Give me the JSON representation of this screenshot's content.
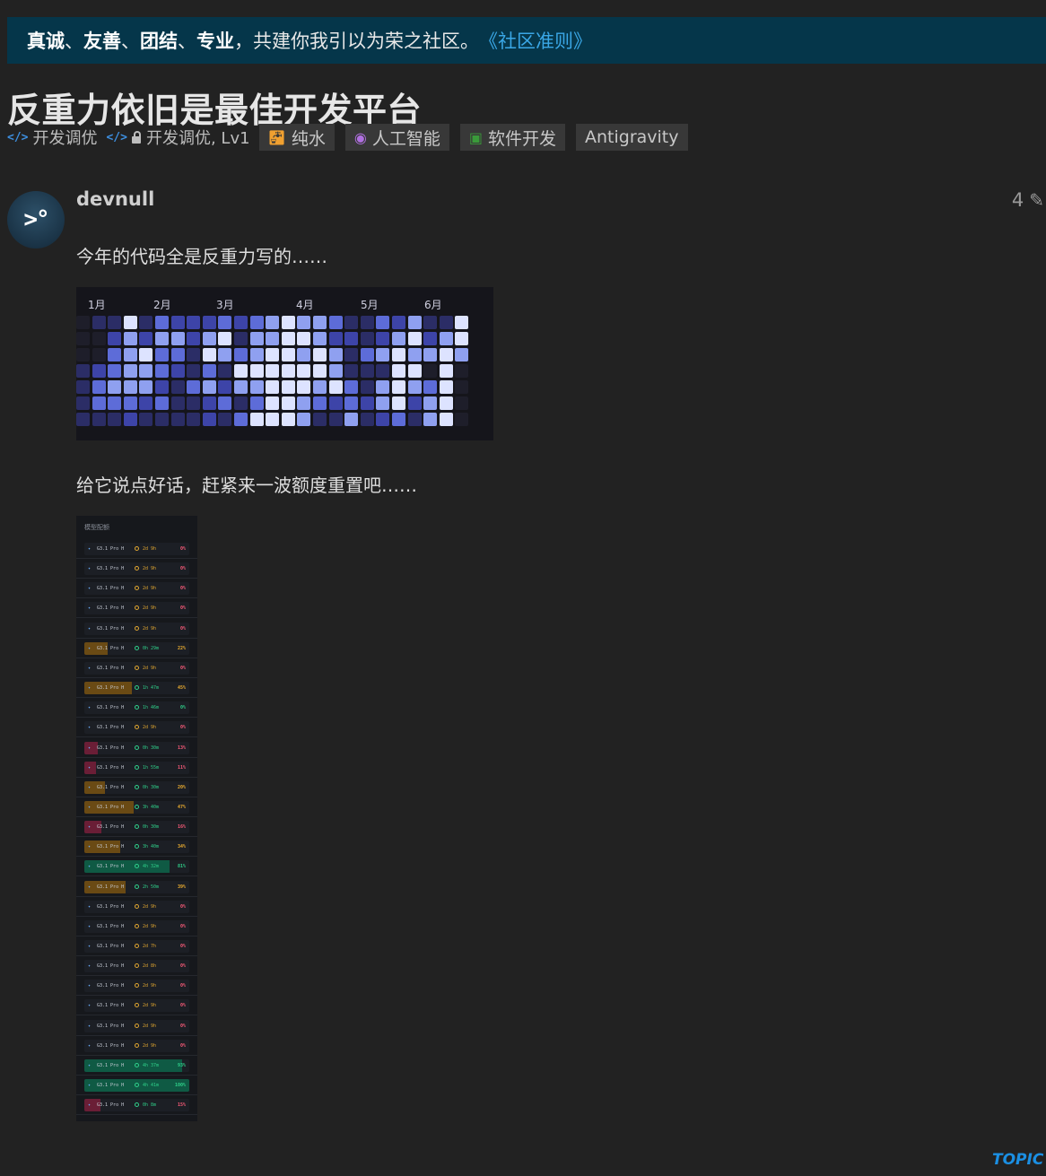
{
  "banner": {
    "bold1": "真诚",
    "sep1": "、",
    "bold2": "友善",
    "sep2": "、",
    "bold3": "团结",
    "sep3": "、",
    "bold4": "专业",
    "rest": "，共建你我引以为荣之社区。",
    "link": "《社区准则》"
  },
  "topic": {
    "title": "反重力依旧是最佳开发平台",
    "breadcrumbs": [
      "开发调优",
      "开发调优, Lv1"
    ],
    "tags": [
      {
        "label": "纯水",
        "icon": "faucet-icon",
        "color": "#f0a030"
      },
      {
        "label": "人工智能",
        "icon": "brain-icon",
        "color": "#b070e0"
      },
      {
        "label": "软件开发",
        "icon": "file-code-icon",
        "color": "#3a9a3a"
      },
      {
        "label": "Antigravity",
        "icon": "",
        "color": ""
      }
    ]
  },
  "post": {
    "avatar_text": ">°",
    "username": "devnull",
    "edit_count": "4",
    "paragraph1": "今年的代码全是反重力写的……",
    "paragraph2": "给它说点好话，赶紧来一波额度重置吧……"
  },
  "heatmap": {
    "months": [
      "1月",
      "2月",
      "3月",
      "4月",
      "5月",
      "6月"
    ],
    "colors": [
      "#1e1e2a",
      "#2b2d66",
      "#3d44a8",
      "#5d6cd8",
      "#8fa0f0",
      "#dde3ff"
    ],
    "columns": [
      [
        0,
        0,
        0,
        1,
        1,
        1,
        1
      ],
      [
        1,
        0,
        0,
        2,
        3,
        3,
        1
      ],
      [
        1,
        2,
        3,
        3,
        4,
        3,
        1
      ],
      [
        5,
        4,
        4,
        4,
        4,
        3,
        2
      ],
      [
        1,
        2,
        5,
        4,
        4,
        2,
        1
      ],
      [
        3,
        4,
        3,
        3,
        2,
        3,
        1
      ],
      [
        2,
        4,
        3,
        2,
        1,
        1,
        1
      ],
      [
        2,
        2,
        1,
        1,
        3,
        1,
        1
      ],
      [
        2,
        4,
        5,
        3,
        4,
        2,
        2
      ],
      [
        3,
        5,
        4,
        1,
        2,
        3,
        1
      ],
      [
        2,
        1,
        3,
        5,
        4,
        1,
        3
      ],
      [
        3,
        4,
        4,
        5,
        4,
        3,
        5
      ],
      [
        4,
        4,
        5,
        5,
        5,
        5,
        5
      ],
      [
        5,
        5,
        5,
        5,
        5,
        5,
        5
      ],
      [
        4,
        5,
        4,
        5,
        5,
        4,
        4
      ],
      [
        4,
        4,
        5,
        5,
        4,
        3,
        1
      ],
      [
        3,
        2,
        4,
        4,
        5,
        2,
        1
      ],
      [
        1,
        2,
        1,
        1,
        3,
        3,
        4
      ],
      [
        1,
        1,
        3,
        1,
        1,
        2,
        1
      ],
      [
        3,
        2,
        4,
        1,
        4,
        4,
        2
      ],
      [
        2,
        4,
        5,
        5,
        5,
        5,
        3
      ],
      [
        4,
        5,
        4,
        5,
        4,
        2,
        1
      ],
      [
        1,
        2,
        4,
        0,
        3,
        4,
        4
      ],
      [
        1,
        4,
        5,
        5,
        5,
        5,
        5
      ],
      [
        5,
        5,
        4,
        0,
        0,
        0,
        0
      ]
    ]
  },
  "quota": {
    "header": "模型配额",
    "rows": [
      {
        "name": "G3.1 Pro H",
        "time": "2d 9h",
        "pct": "0%",
        "fill": 0,
        "tone": "yellow"
      },
      {
        "name": "G3.1 Pro H",
        "time": "2d 9h",
        "pct": "0%",
        "fill": 0,
        "tone": "yellow"
      },
      {
        "name": "G3.1 Pro H",
        "time": "2d 9h",
        "pct": "0%",
        "fill": 0,
        "tone": "yellow"
      },
      {
        "name": "G3.1 Pro H",
        "time": "2d 9h",
        "pct": "0%",
        "fill": 0,
        "tone": "yellow"
      },
      {
        "name": "G3.1 Pro H",
        "time": "2d 9h",
        "pct": "0%",
        "fill": 0,
        "tone": "yellow"
      },
      {
        "name": "G3.1 Pro H",
        "time": "0h 29m",
        "pct": "22%",
        "fill": 22,
        "tone": "amber"
      },
      {
        "name": "G3.1 Pro H",
        "time": "2d 9h",
        "pct": "0%",
        "fill": 0,
        "tone": "yellow"
      },
      {
        "name": "G3.1 Pro H",
        "time": "1h 47m",
        "pct": "45%",
        "fill": 45,
        "tone": "amber"
      },
      {
        "name": "G3.1 Pro H",
        "time": "1h 46m",
        "pct": "0%",
        "fill": 0,
        "tone": "green"
      },
      {
        "name": "G3.1 Pro H",
        "time": "2d 9h",
        "pct": "0%",
        "fill": 0,
        "tone": "yellow"
      },
      {
        "name": "G3.1 Pro H",
        "time": "0h 30m",
        "pct": "13%",
        "fill": 13,
        "tone": "red"
      },
      {
        "name": "G3.1 Pro H",
        "time": "1h 55m",
        "pct": "11%",
        "fill": 11,
        "tone": "red"
      },
      {
        "name": "G3.1 Pro H",
        "time": "0h 30m",
        "pct": "20%",
        "fill": 20,
        "tone": "amber"
      },
      {
        "name": "G3.1 Pro H",
        "time": "3h 40m",
        "pct": "47%",
        "fill": 47,
        "tone": "amber"
      },
      {
        "name": "G3.1 Pro H",
        "time": "0h 30m",
        "pct": "16%",
        "fill": 16,
        "tone": "red"
      },
      {
        "name": "G3.1 Pro H",
        "time": "3h 40m",
        "pct": "34%",
        "fill": 34,
        "tone": "amber"
      },
      {
        "name": "G3.1 Pro H",
        "time": "4h 32m",
        "pct": "81%",
        "fill": 81,
        "tone": "green"
      },
      {
        "name": "G3.1 Pro H",
        "time": "2h 50m",
        "pct": "39%",
        "fill": 39,
        "tone": "amber"
      },
      {
        "name": "G3.1 Pro H",
        "time": "2d 9h",
        "pct": "0%",
        "fill": 0,
        "tone": "yellow"
      },
      {
        "name": "G3.1 Pro H",
        "time": "2d 9h",
        "pct": "0%",
        "fill": 0,
        "tone": "yellow"
      },
      {
        "name": "G3.1 Pro H",
        "time": "2d 7h",
        "pct": "0%",
        "fill": 0,
        "tone": "yellow"
      },
      {
        "name": "G3.1 Pro H",
        "time": "2d 8h",
        "pct": "0%",
        "fill": 0,
        "tone": "yellow"
      },
      {
        "name": "G3.1 Pro H",
        "time": "2d 9h",
        "pct": "0%",
        "fill": 0,
        "tone": "yellow"
      },
      {
        "name": "G3.1 Pro H",
        "time": "2d 9h",
        "pct": "0%",
        "fill": 0,
        "tone": "yellow"
      },
      {
        "name": "G3.1 Pro H",
        "time": "2d 9h",
        "pct": "0%",
        "fill": 0,
        "tone": "yellow"
      },
      {
        "name": "G3.1 Pro H",
        "time": "2d 9h",
        "pct": "0%",
        "fill": 0,
        "tone": "yellow"
      },
      {
        "name": "G3.1 Pro H",
        "time": "4h 37m",
        "pct": "93%",
        "fill": 93,
        "tone": "green"
      },
      {
        "name": "G3.1 Pro H",
        "time": "4h 41m",
        "pct": "100%",
        "fill": 100,
        "tone": "green"
      },
      {
        "name": "G3.1 Pro H",
        "time": "0h 8m",
        "pct": "15%",
        "fill": 15,
        "tone": "red"
      }
    ]
  },
  "footer": {
    "topic_label": "TOPIC"
  },
  "colors": {
    "banner_bg": "#05364a",
    "link": "#3aa7e6",
    "topic_label": "#1b8fe3"
  }
}
